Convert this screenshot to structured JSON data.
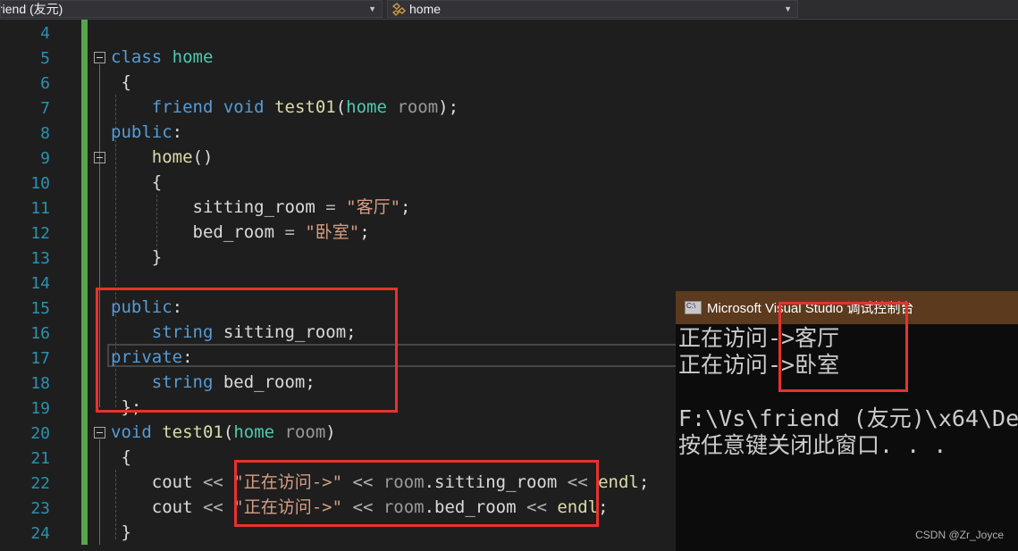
{
  "nav": {
    "scope_combo": "riend (友元)",
    "member_combo": "home"
  },
  "editor": {
    "line_numbers": [
      "4",
      "5",
      "6",
      "7",
      "8",
      "9",
      "10",
      "11",
      "12",
      "13",
      "14",
      "15",
      "16",
      "17",
      "18",
      "19",
      "20",
      "21",
      "22",
      "23",
      "24"
    ],
    "lines": {
      "l5": [
        "class",
        "home"
      ],
      "l6": [
        "{"
      ],
      "l7": [
        "friend",
        "void",
        "test01",
        "(",
        "home",
        "room",
        ");"
      ],
      "l8": [
        "public",
        ":"
      ],
      "l9": [
        "home",
        "()"
      ],
      "l10": [
        "{"
      ],
      "l11": [
        "sitting_room",
        " = ",
        "\"客厅\"",
        ";"
      ],
      "l12": [
        "bed_room",
        " = ",
        "\"卧室\"",
        ";"
      ],
      "l13": [
        "}"
      ],
      "l15": [
        "public",
        ":"
      ],
      "l16": [
        "string",
        "sitting_room",
        ";"
      ],
      "l17": [
        "private",
        ":"
      ],
      "l18": [
        "string",
        "bed_room",
        ";"
      ],
      "l19": [
        "};"
      ],
      "l20": [
        "void",
        "test01",
        "(",
        "home",
        "room",
        ")"
      ],
      "l21": [
        "{"
      ],
      "l22": [
        "cout",
        " << ",
        "\"正在访问->\"",
        " << ",
        "room",
        ".",
        "sitting_room",
        " << ",
        "endl",
        ";"
      ],
      "l23": [
        "cout",
        " << ",
        "\"正在访问->\"",
        " << ",
        "room",
        ".",
        "bed_room",
        " << ",
        "endl",
        ";"
      ],
      "l24": [
        "}"
      ]
    }
  },
  "console": {
    "title": "Microsoft Visual Studio 调试控制台",
    "output": [
      "正在访问->客厅",
      "正在访问->卧室",
      "",
      "F:\\Vs\\friend (友元)\\x64\\De",
      "按任意键关闭此窗口. . ."
    ]
  },
  "watermark": "CSDN @Zr_Joyce",
  "colors": {
    "keyword": "#569cd6",
    "type": "#4ec9b0",
    "function": "#dcdcaa",
    "string": "#d69d85",
    "line_number": "#2b91af",
    "highlight_box": "#e8322e",
    "console_title_bg": "#5b3a1e"
  }
}
